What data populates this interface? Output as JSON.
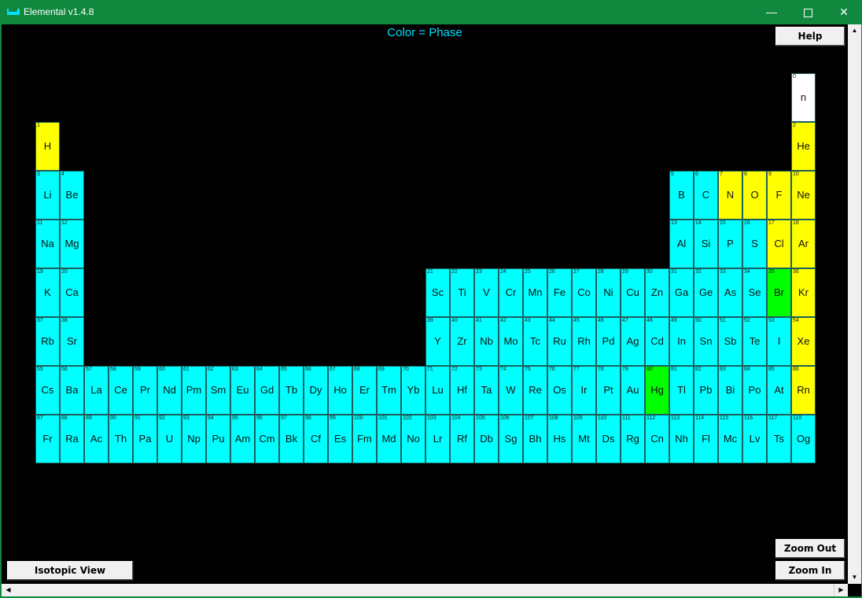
{
  "window": {
    "title": "Elemental v1.4.8",
    "minimize_icon": "minimize-icon",
    "maximize_icon": "maximize-icon",
    "close_icon": "close-icon"
  },
  "legend": "Color = Phase",
  "buttons": {
    "help": "Help",
    "isotopic": "Isotopic View",
    "zoom_out": "Zoom Out",
    "zoom_in": "Zoom In"
  },
  "phase_colors": {
    "solid": "#00ffff",
    "gas": "#ffff00",
    "liquid": "#00ff00",
    "none": "#ffffff"
  },
  "elements": [
    {
      "z": 0,
      "s": "n",
      "p": "none"
    },
    {
      "z": 1,
      "s": "H",
      "p": "gas"
    },
    {
      "z": 2,
      "s": "He",
      "p": "gas"
    },
    {
      "z": 3,
      "s": "Li",
      "p": "solid"
    },
    {
      "z": 4,
      "s": "Be",
      "p": "solid"
    },
    {
      "z": 5,
      "s": "B",
      "p": "solid"
    },
    {
      "z": 6,
      "s": "C",
      "p": "solid"
    },
    {
      "z": 7,
      "s": "N",
      "p": "gas"
    },
    {
      "z": 8,
      "s": "O",
      "p": "gas"
    },
    {
      "z": 9,
      "s": "F",
      "p": "gas"
    },
    {
      "z": 10,
      "s": "Ne",
      "p": "gas"
    },
    {
      "z": 11,
      "s": "Na",
      "p": "solid"
    },
    {
      "z": 12,
      "s": "Mg",
      "p": "solid"
    },
    {
      "z": 13,
      "s": "Al",
      "p": "solid"
    },
    {
      "z": 14,
      "s": "Si",
      "p": "solid"
    },
    {
      "z": 15,
      "s": "P",
      "p": "solid"
    },
    {
      "z": 16,
      "s": "S",
      "p": "solid"
    },
    {
      "z": 17,
      "s": "Cl",
      "p": "gas"
    },
    {
      "z": 18,
      "s": "Ar",
      "p": "gas"
    },
    {
      "z": 19,
      "s": "K",
      "p": "solid"
    },
    {
      "z": 20,
      "s": "Ca",
      "p": "solid"
    },
    {
      "z": 21,
      "s": "Sc",
      "p": "solid"
    },
    {
      "z": 22,
      "s": "Ti",
      "p": "solid"
    },
    {
      "z": 23,
      "s": "V",
      "p": "solid"
    },
    {
      "z": 24,
      "s": "Cr",
      "p": "solid"
    },
    {
      "z": 25,
      "s": "Mn",
      "p": "solid"
    },
    {
      "z": 26,
      "s": "Fe",
      "p": "solid"
    },
    {
      "z": 27,
      "s": "Co",
      "p": "solid"
    },
    {
      "z": 28,
      "s": "Ni",
      "p": "solid"
    },
    {
      "z": 29,
      "s": "Cu",
      "p": "solid"
    },
    {
      "z": 30,
      "s": "Zn",
      "p": "solid"
    },
    {
      "z": 31,
      "s": "Ga",
      "p": "solid"
    },
    {
      "z": 32,
      "s": "Ge",
      "p": "solid"
    },
    {
      "z": 33,
      "s": "As",
      "p": "solid"
    },
    {
      "z": 34,
      "s": "Se",
      "p": "solid"
    },
    {
      "z": 35,
      "s": "Br",
      "p": "liquid"
    },
    {
      "z": 36,
      "s": "Kr",
      "p": "gas"
    },
    {
      "z": 37,
      "s": "Rb",
      "p": "solid"
    },
    {
      "z": 38,
      "s": "Sr",
      "p": "solid"
    },
    {
      "z": 39,
      "s": "Y",
      "p": "solid"
    },
    {
      "z": 40,
      "s": "Zr",
      "p": "solid"
    },
    {
      "z": 41,
      "s": "Nb",
      "p": "solid"
    },
    {
      "z": 42,
      "s": "Mo",
      "p": "solid"
    },
    {
      "z": 43,
      "s": "Tc",
      "p": "solid"
    },
    {
      "z": 44,
      "s": "Ru",
      "p": "solid"
    },
    {
      "z": 45,
      "s": "Rh",
      "p": "solid"
    },
    {
      "z": 46,
      "s": "Pd",
      "p": "solid"
    },
    {
      "z": 47,
      "s": "Ag",
      "p": "solid"
    },
    {
      "z": 48,
      "s": "Cd",
      "p": "solid"
    },
    {
      "z": 49,
      "s": "In",
      "p": "solid"
    },
    {
      "z": 50,
      "s": "Sn",
      "p": "solid"
    },
    {
      "z": 51,
      "s": "Sb",
      "p": "solid"
    },
    {
      "z": 52,
      "s": "Te",
      "p": "solid"
    },
    {
      "z": 53,
      "s": "I",
      "p": "solid"
    },
    {
      "z": 54,
      "s": "Xe",
      "p": "gas"
    },
    {
      "z": 55,
      "s": "Cs",
      "p": "solid"
    },
    {
      "z": 56,
      "s": "Ba",
      "p": "solid"
    },
    {
      "z": 57,
      "s": "La",
      "p": "solid"
    },
    {
      "z": 58,
      "s": "Ce",
      "p": "solid"
    },
    {
      "z": 59,
      "s": "Pr",
      "p": "solid"
    },
    {
      "z": 60,
      "s": "Nd",
      "p": "solid"
    },
    {
      "z": 61,
      "s": "Pm",
      "p": "solid"
    },
    {
      "z": 62,
      "s": "Sm",
      "p": "solid"
    },
    {
      "z": 63,
      "s": "Eu",
      "p": "solid"
    },
    {
      "z": 64,
      "s": "Gd",
      "p": "solid"
    },
    {
      "z": 65,
      "s": "Tb",
      "p": "solid"
    },
    {
      "z": 66,
      "s": "Dy",
      "p": "solid"
    },
    {
      "z": 67,
      "s": "Ho",
      "p": "solid"
    },
    {
      "z": 68,
      "s": "Er",
      "p": "solid"
    },
    {
      "z": 69,
      "s": "Tm",
      "p": "solid"
    },
    {
      "z": 70,
      "s": "Yb",
      "p": "solid"
    },
    {
      "z": 71,
      "s": "Lu",
      "p": "solid"
    },
    {
      "z": 72,
      "s": "Hf",
      "p": "solid"
    },
    {
      "z": 73,
      "s": "Ta",
      "p": "solid"
    },
    {
      "z": 74,
      "s": "W",
      "p": "solid"
    },
    {
      "z": 75,
      "s": "Re",
      "p": "solid"
    },
    {
      "z": 76,
      "s": "Os",
      "p": "solid"
    },
    {
      "z": 77,
      "s": "Ir",
      "p": "solid"
    },
    {
      "z": 78,
      "s": "Pt",
      "p": "solid"
    },
    {
      "z": 79,
      "s": "Au",
      "p": "solid"
    },
    {
      "z": 80,
      "s": "Hg",
      "p": "liquid"
    },
    {
      "z": 81,
      "s": "Tl",
      "p": "solid"
    },
    {
      "z": 82,
      "s": "Pb",
      "p": "solid"
    },
    {
      "z": 83,
      "s": "Bi",
      "p": "solid"
    },
    {
      "z": 84,
      "s": "Po",
      "p": "solid"
    },
    {
      "z": 85,
      "s": "At",
      "p": "solid"
    },
    {
      "z": 86,
      "s": "Rn",
      "p": "gas"
    },
    {
      "z": 87,
      "s": "Fr",
      "p": "solid"
    },
    {
      "z": 88,
      "s": "Ra",
      "p": "solid"
    },
    {
      "z": 89,
      "s": "Ac",
      "p": "solid"
    },
    {
      "z": 90,
      "s": "Th",
      "p": "solid"
    },
    {
      "z": 91,
      "s": "Pa",
      "p": "solid"
    },
    {
      "z": 92,
      "s": "U",
      "p": "solid"
    },
    {
      "z": 93,
      "s": "Np",
      "p": "solid"
    },
    {
      "z": 94,
      "s": "Pu",
      "p": "solid"
    },
    {
      "z": 95,
      "s": "Am",
      "p": "solid"
    },
    {
      "z": 96,
      "s": "Cm",
      "p": "solid"
    },
    {
      "z": 97,
      "s": "Bk",
      "p": "solid"
    },
    {
      "z": 98,
      "s": "Cf",
      "p": "solid"
    },
    {
      "z": 99,
      "s": "Es",
      "p": "solid"
    },
    {
      "z": 100,
      "s": "Fm",
      "p": "solid"
    },
    {
      "z": 101,
      "s": "Md",
      "p": "solid"
    },
    {
      "z": 102,
      "s": "No",
      "p": "solid"
    },
    {
      "z": 103,
      "s": "Lr",
      "p": "solid"
    },
    {
      "z": 104,
      "s": "Rf",
      "p": "solid"
    },
    {
      "z": 105,
      "s": "Db",
      "p": "solid"
    },
    {
      "z": 106,
      "s": "Sg",
      "p": "solid"
    },
    {
      "z": 107,
      "s": "Bh",
      "p": "solid"
    },
    {
      "z": 108,
      "s": "Hs",
      "p": "solid"
    },
    {
      "z": 109,
      "s": "Mt",
      "p": "solid"
    },
    {
      "z": 110,
      "s": "Ds",
      "p": "solid"
    },
    {
      "z": 111,
      "s": "Rg",
      "p": "solid"
    },
    {
      "z": 112,
      "s": "Cn",
      "p": "solid"
    },
    {
      "z": 113,
      "s": "Nh",
      "p": "solid"
    },
    {
      "z": 114,
      "s": "Fl",
      "p": "solid"
    },
    {
      "z": 115,
      "s": "Mc",
      "p": "solid"
    },
    {
      "z": 116,
      "s": "Lv",
      "p": "solid"
    },
    {
      "z": 117,
      "s": "Ts",
      "p": "solid"
    },
    {
      "z": 118,
      "s": "Og",
      "p": "solid"
    }
  ]
}
